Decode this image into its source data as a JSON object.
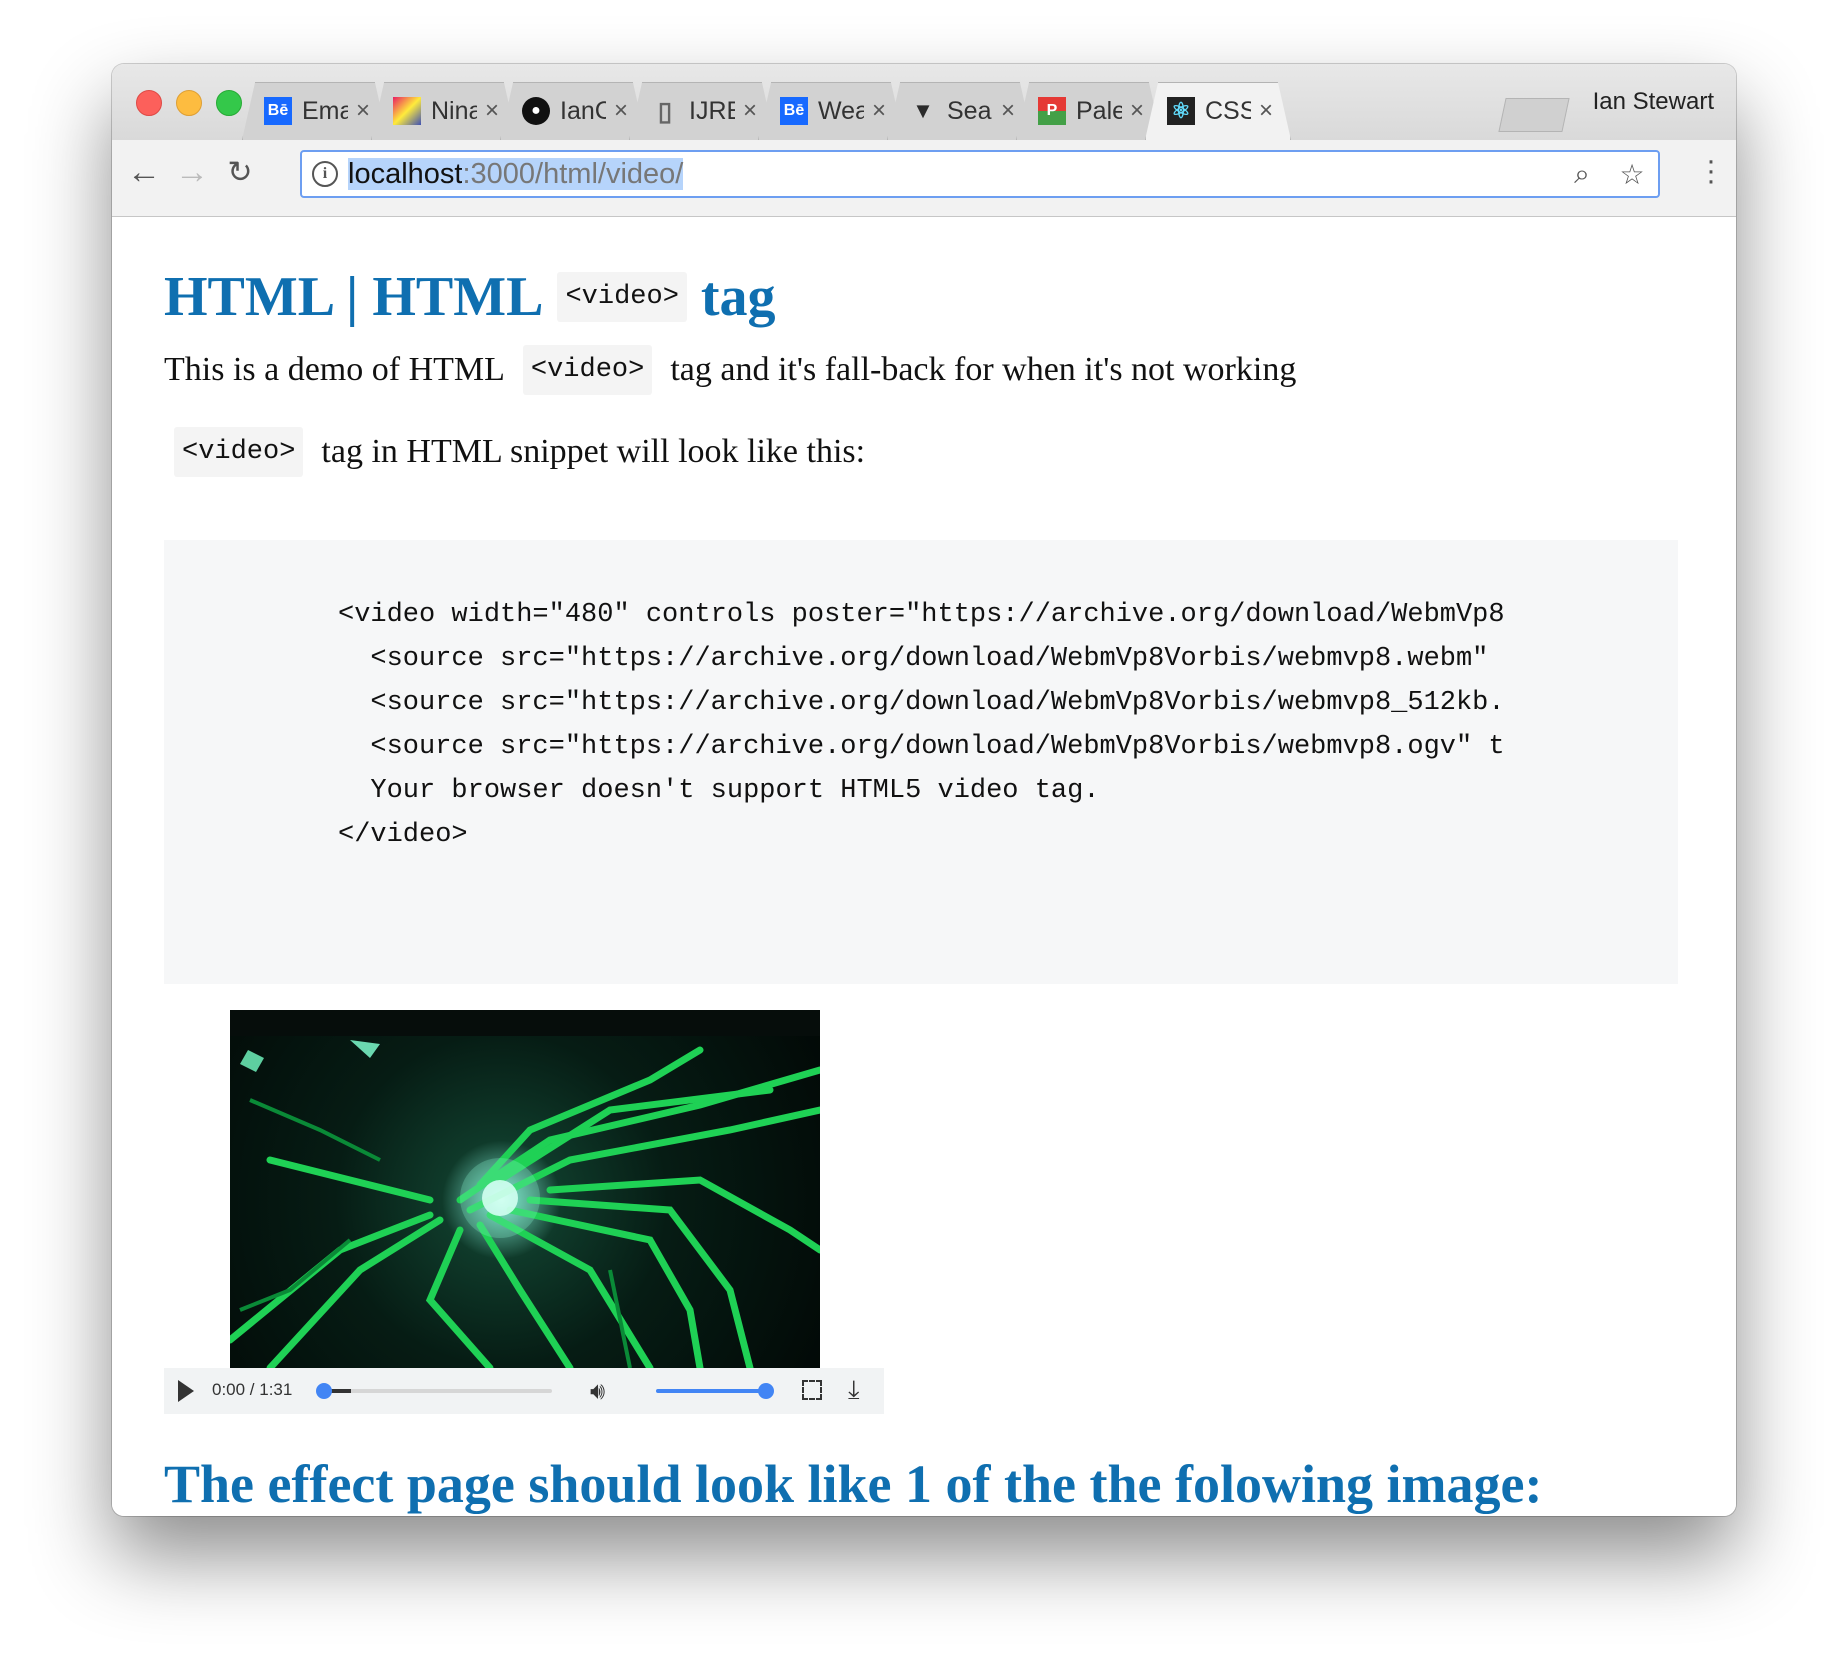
{
  "browser": {
    "tabs": [
      {
        "title": "Ema",
        "favicon": "behance-icon",
        "favicon_text": "Bē",
        "color": "#1769ff"
      },
      {
        "title": "Nina",
        "favicon": "document-colorful-icon",
        "favicon_text": "",
        "color": "#222222"
      },
      {
        "title": "IanC",
        "favicon": "github-icon",
        "favicon_text": "●",
        "color": "#111111"
      },
      {
        "title": "IJRE",
        "favicon": "page-icon",
        "favicon_text": "▯",
        "color": "#777777"
      },
      {
        "title": "Wea",
        "favicon": "behance-icon",
        "favicon_text": "Bē",
        "color": "#1769ff"
      },
      {
        "title": "Sea",
        "favicon": "vue-like-icon",
        "favicon_text": "▼",
        "color": "#2b2b2b"
      },
      {
        "title": "Pale",
        "favicon": "palette-icon",
        "favicon_text": "P",
        "color": "#f4b400"
      },
      {
        "title": "CSS",
        "favicon": "react-icon",
        "favicon_text": "⚛",
        "color": "#222222"
      }
    ],
    "active_tab_index": 7,
    "profile_name": "Ian Stewart",
    "url_host": "localhost",
    "url_path": ":3000/html/video/"
  },
  "page": {
    "heading_part1": "HTML | HTML",
    "heading_code": "<video>",
    "heading_part2": "tag",
    "intro_text1": "This is a demo of HTML",
    "intro_code": "<video>",
    "intro_text2": "tag and it's fall-back for when it's not working",
    "snippet_code": "<video>",
    "snippet_text": "tag in HTML snippet will look like this:",
    "code_lines": [
      "<video width=\"480\" controls poster=\"https://archive.org/download/WebmVp8",
      "  <source src=\"https://archive.org/download/WebmVp8Vorbis/webmvp8.webm\"",
      "  <source src=\"https://archive.org/download/WebmVp8Vorbis/webmvp8_512kb.",
      "  <source src=\"https://archive.org/download/WebmVp8Vorbis/webmvp8.ogv\" t",
      "  Your browser doesn't support HTML5 video tag.",
      "</video>"
    ],
    "video": {
      "time_display": "0:00 / 1:31",
      "progress_fraction": 0.0,
      "volume_fraction": 1.0
    },
    "subheading": "The effect page should look like 1 of the the folowing image:"
  }
}
